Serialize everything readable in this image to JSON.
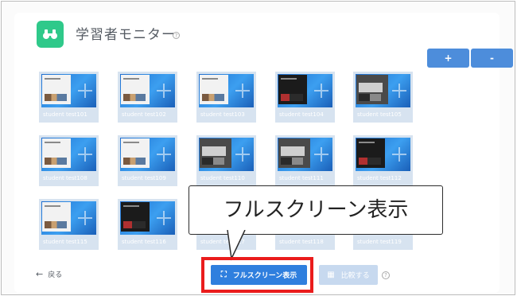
{
  "header": {
    "title": "学習者モニター",
    "help": "?"
  },
  "zoom": {
    "plus_label": "+",
    "minus_label": "-"
  },
  "tiles": [
    {
      "label": "student test101",
      "screen": "normal"
    },
    {
      "label": "student test102",
      "screen": "normal"
    },
    {
      "label": "student test103",
      "screen": "normal"
    },
    {
      "label": "student test104",
      "screen": "dark"
    },
    {
      "label": "student test105",
      "screen": "photo"
    },
    {
      "label": "student test108",
      "screen": "normal"
    },
    {
      "label": "student test109",
      "screen": "normal"
    },
    {
      "label": "student test110",
      "screen": "photo"
    },
    {
      "label": "student test111",
      "screen": "photo"
    },
    {
      "label": "student test112",
      "screen": "dark"
    },
    {
      "label": "student test115",
      "screen": "normal"
    },
    {
      "label": "student test116",
      "screen": "dark"
    },
    {
      "label": "student test117",
      "screen": "normal"
    },
    {
      "label": "student test118",
      "screen": "normal"
    },
    {
      "label": "student test119",
      "screen": "normal"
    }
  ],
  "callout": {
    "text": "フルスクリーン表示"
  },
  "footer": {
    "back_arrow": "←",
    "back_label": "戻る",
    "fullscreen_icon": "⛶",
    "fullscreen_label": "フルスクリーン表示",
    "compare_icon": "▦",
    "compare_label": "比較する",
    "help": "?"
  },
  "colors": {
    "accent": "#2f7fde",
    "app_icon": "#2fc98a",
    "highlight": "#ea1c1c"
  }
}
